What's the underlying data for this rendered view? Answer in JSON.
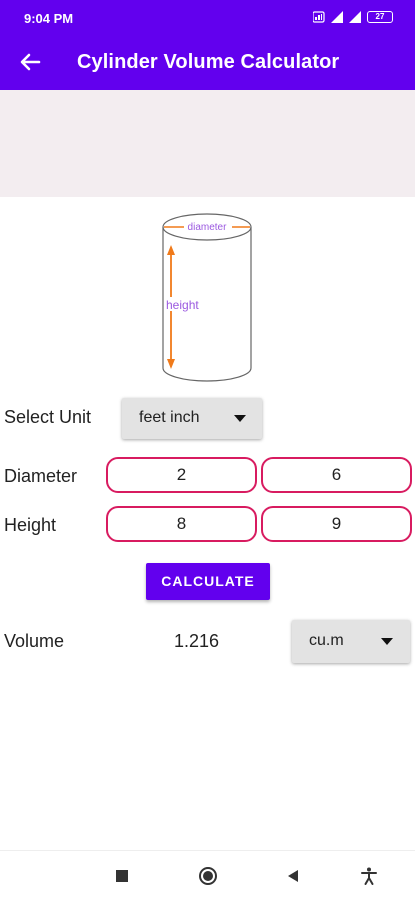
{
  "status_bar": {
    "time": "9:04 PM",
    "battery": "27"
  },
  "app_bar": {
    "title": "Cylinder Volume Calculator",
    "back_icon": "arrow-back-icon"
  },
  "diagram": {
    "diameter_label": "diameter",
    "height_label": "height"
  },
  "form": {
    "unit_label": "Select Unit",
    "unit_selected": "feet inch",
    "diameter_label": "Diameter",
    "diameter_feet": "2",
    "diameter_inch": "6",
    "height_label": "Height",
    "height_feet": "8",
    "height_inch": "9",
    "calculate_label": "CALCULATE"
  },
  "result": {
    "volume_label": "Volume",
    "volume_value": "1.216",
    "volume_unit": "cu.m"
  },
  "navigation": {
    "buttons": [
      "recents-square-icon",
      "home-circle-icon",
      "back-triangle-icon",
      "accessibility-icon"
    ]
  },
  "colors": {
    "primary": "#6200ee",
    "field_border": "#d81b60",
    "diagram_label": "#9b59e0",
    "diagram_arrow": "#f07a1a"
  }
}
